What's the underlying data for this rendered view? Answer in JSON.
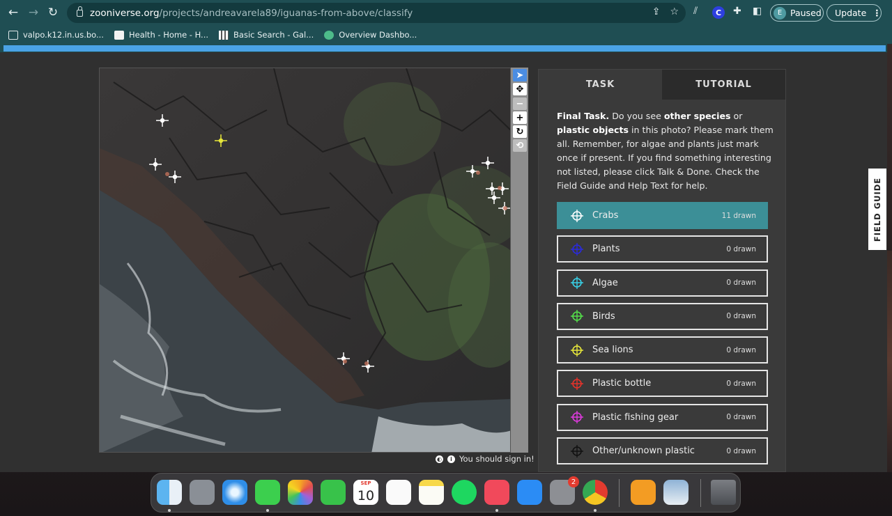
{
  "browser": {
    "url_host": "zooniverse.org",
    "url_path": "/projects/andreavarela89/iguanas-from-above/classify",
    "profile_initial": "E",
    "profile_status": "Paused",
    "update_label": "Update",
    "update_menu": "⋮",
    "ext_c": "C"
  },
  "bookmarks": [
    {
      "label": "valpo.k12.in.us.bo...",
      "icon": "folder-icon"
    },
    {
      "label": "Health - Home - H...",
      "icon": "health-icon"
    },
    {
      "label": "Basic Search - Gal...",
      "icon": "gale-icon"
    },
    {
      "label": "Overview Dashbo...",
      "icon": "overview-icon"
    }
  ],
  "classifier": {
    "signin_text": "You should sign in!",
    "tabs": {
      "task": "TASK",
      "tutorial": "TUTORIAL"
    },
    "instructions": {
      "lead": "Final Task.",
      "part1": " Do you see ",
      "bold1": "other species",
      "part2": " or ",
      "bold2": "plastic objects",
      "part3": " in this photo? Please mark them all. Remember, for algae and plants just mark once if present. If you find something interesting not listed, please click Talk & Done. Check the Field Guide and Help Text for help."
    },
    "tools": [
      {
        "label": "Crabs",
        "count": "11 drawn",
        "color": "#ffffff",
        "selected": true
      },
      {
        "label": "Plants",
        "count": "0 drawn",
        "color": "#2a2ae0",
        "selected": false
      },
      {
        "label": "Algae",
        "count": "0 drawn",
        "color": "#38d2e8",
        "selected": false
      },
      {
        "label": "Birds",
        "count": "0 drawn",
        "color": "#54e24a",
        "selected": false
      },
      {
        "label": "Sea lions",
        "count": "0 drawn",
        "color": "#e8e83a",
        "selected": false
      },
      {
        "label": "Plastic bottle",
        "count": "0 drawn",
        "color": "#e8322a",
        "selected": false
      },
      {
        "label": "Plastic fishing gear",
        "count": "0 drawn",
        "color": "#e03ae0",
        "selected": false
      },
      {
        "label": "Other/unknown plastic",
        "count": "0 drawn",
        "color": "#111111",
        "selected": false
      }
    ],
    "field_guide_label": "FIELD GUIDE"
  },
  "dock": {
    "calendar_month": "SEP",
    "calendar_day": "10",
    "settings_badge": "2"
  }
}
